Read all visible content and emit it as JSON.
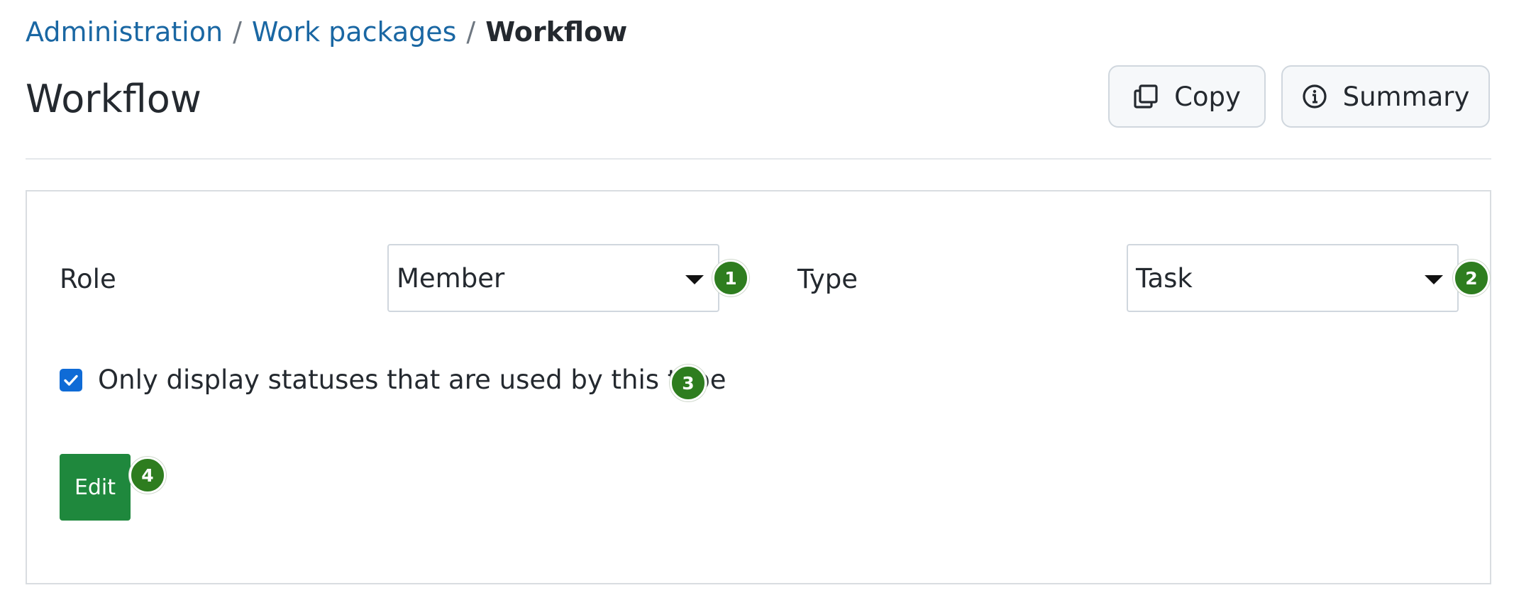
{
  "breadcrumb": {
    "items": [
      "Administration",
      "Work packages"
    ],
    "separator": "/",
    "current": "Workflow"
  },
  "header": {
    "title": "Workflow",
    "copy_label": "Copy",
    "summary_label": "Summary",
    "copy_icon": "copy-icon",
    "summary_icon": "info-icon"
  },
  "form": {
    "role_label": "Role",
    "role_value": "Member",
    "type_label": "Type",
    "type_value": "Task",
    "only_used_statuses_label": "Only display statuses that are used by this type",
    "only_used_statuses_checked": true,
    "edit_label": "Edit"
  },
  "annotations": [
    "1",
    "2",
    "3",
    "4"
  ],
  "colors": {
    "link": "#1a67a3",
    "primary_button": "#1f883d",
    "badge": "#2e7d1f",
    "checkbox": "#0f6bd6"
  }
}
